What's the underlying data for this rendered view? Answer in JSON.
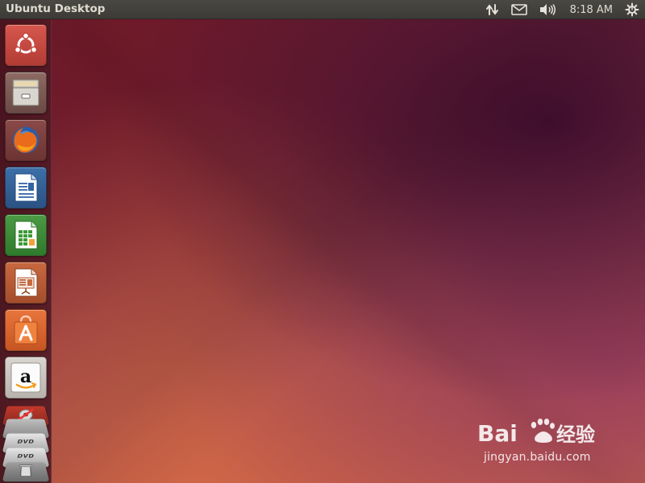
{
  "top_panel": {
    "title": "Ubuntu Desktop",
    "indicators": {
      "network_icon": "network-updown-icon",
      "messaging_icon": "envelope-icon",
      "sound_icon": "speaker-volume-icon",
      "clock": "8:18 AM",
      "session_icon": "gear-power-icon"
    }
  },
  "launcher": {
    "items": [
      {
        "name": "dash",
        "icon": "ubuntu-logo-icon"
      },
      {
        "name": "files",
        "icon": "file-cabinet-icon"
      },
      {
        "name": "firefox",
        "icon": "firefox-icon"
      },
      {
        "name": "libreoffice-writer",
        "icon": "writer-document-icon"
      },
      {
        "name": "libreoffice-calc",
        "icon": "calc-spreadsheet-icon"
      },
      {
        "name": "libreoffice-impress",
        "icon": "impress-presentation-icon"
      },
      {
        "name": "ubuntu-software-center",
        "icon": "shopping-bag-icon"
      },
      {
        "name": "amazon",
        "icon": "amazon-logo-icon"
      }
    ],
    "stacked": [
      {
        "name": "system-settings",
        "icon": "settings-icon"
      },
      {
        "name": "dvd-1",
        "label": "DVD"
      },
      {
        "name": "dvd-2",
        "label": "DVD"
      },
      {
        "name": "trash",
        "icon": "trash-icon"
      }
    ]
  },
  "watermark": {
    "brand": "Baidu经验",
    "url": "jingyan.baidu.com"
  },
  "colors": {
    "panel_bg": "#3c3b37",
    "panel_text": "#dfdbd2",
    "desktop_top": "#6b1f33",
    "desktop_bottom": "#c9664c"
  }
}
